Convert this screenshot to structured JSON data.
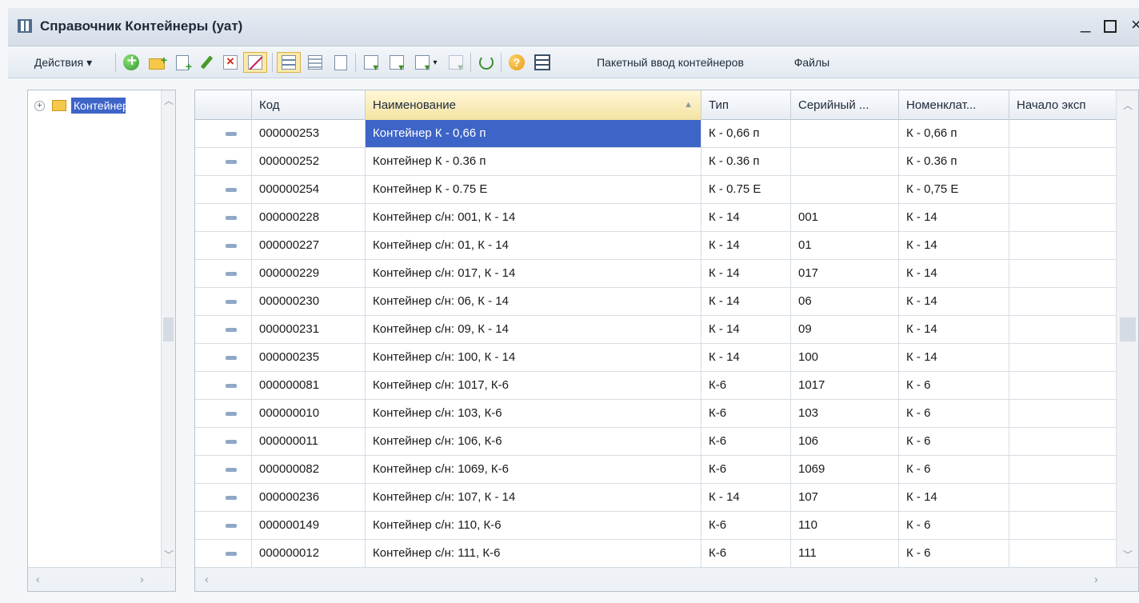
{
  "window": {
    "title": "Справочник Контейнеры (уат)",
    "minimize": "_",
    "close": "×"
  },
  "toolbar": {
    "actions_label": "Действия ▾",
    "batch_input_label": "Пакетный ввод контейнеров",
    "files_label": "Файлы",
    "icons": [
      "add-icon",
      "add-group-icon",
      "copy-icon",
      "edit-icon",
      "delete-icon",
      "mark-deletion-icon",
      "hierarchy-view-icon",
      "list-view-icon",
      "level-up-icon",
      "filter-icon",
      "filter-by-value-icon",
      "filter-dropdown-icon",
      "clear-filter-icon",
      "refresh-icon",
      "help-icon",
      "settings-table-icon"
    ]
  },
  "tree": {
    "expand": "+",
    "label": "Контейнеры"
  },
  "grid": {
    "columns": [
      "",
      "Код",
      "Наименование",
      "Тип",
      "Серийный ...",
      "Номенклат...",
      "Начало эксп"
    ],
    "rows": [
      {
        "code": "000000253",
        "name": "Контейнер К - 0,66 п",
        "type": "К - 0,66 п",
        "serial": "",
        "nomen": "К - 0,66 п",
        "start": ""
      },
      {
        "code": "000000252",
        "name": "Контейнер К - 0.36 п",
        "type": "К - 0.36 п",
        "serial": "",
        "nomen": "К - 0.36 п",
        "start": ""
      },
      {
        "code": "000000254",
        "name": "Контейнер К - 0.75 Е",
        "type": "К - 0.75 Е",
        "serial": "",
        "nomen": "К - 0,75 Е",
        "start": ""
      },
      {
        "code": "000000228",
        "name": "Контейнер с/н: 001, К - 14",
        "type": "К - 14",
        "serial": "001",
        "nomen": "К - 14",
        "start": ""
      },
      {
        "code": "000000227",
        "name": "Контейнер с/н: 01, К - 14",
        "type": "К - 14",
        "serial": "01",
        "nomen": "К - 14",
        "start": ""
      },
      {
        "code": "000000229",
        "name": "Контейнер с/н: 017, К - 14",
        "type": "К - 14",
        "serial": "017",
        "nomen": "К - 14",
        "start": ""
      },
      {
        "code": "000000230",
        "name": "Контейнер с/н: 06, К - 14",
        "type": "К - 14",
        "serial": "06",
        "nomen": "К - 14",
        "start": ""
      },
      {
        "code": "000000231",
        "name": "Контейнер с/н: 09, К - 14",
        "type": "К - 14",
        "serial": "09",
        "nomen": "К - 14",
        "start": ""
      },
      {
        "code": "000000235",
        "name": "Контейнер с/н: 100, К - 14",
        "type": "К - 14",
        "serial": "100",
        "nomen": "К - 14",
        "start": ""
      },
      {
        "code": "000000081",
        "name": "Контейнер с/н: 1017, К-6",
        "type": "К-6",
        "serial": "1017",
        "nomen": "К - 6",
        "start": ""
      },
      {
        "code": "000000010",
        "name": "Контейнер с/н: 103, К-6",
        "type": "К-6",
        "serial": "103",
        "nomen": "К - 6",
        "start": ""
      },
      {
        "code": "000000011",
        "name": "Контейнер с/н: 106, К-6",
        "type": "К-6",
        "serial": "106",
        "nomen": "К - 6",
        "start": ""
      },
      {
        "code": "000000082",
        "name": "Контейнер с/н: 1069, К-6",
        "type": "К-6",
        "serial": "1069",
        "nomen": "К - 6",
        "start": ""
      },
      {
        "code": "000000236",
        "name": "Контейнер с/н: 107, К - 14",
        "type": "К - 14",
        "serial": "107",
        "nomen": "К - 14",
        "start": ""
      },
      {
        "code": "000000149",
        "name": "Контейнер с/н: 110, К-6",
        "type": "К-6",
        "serial": "110",
        "nomen": "К - 6",
        "start": ""
      },
      {
        "code": "000000012",
        "name": "Контейнер с/н: 111, К-6",
        "type": "К-6",
        "serial": "111",
        "nomen": "К - 6",
        "start": ""
      }
    ],
    "selected_row": 0
  },
  "colors": {
    "selection": "#3d64c7",
    "folder": "#f5c84a"
  }
}
